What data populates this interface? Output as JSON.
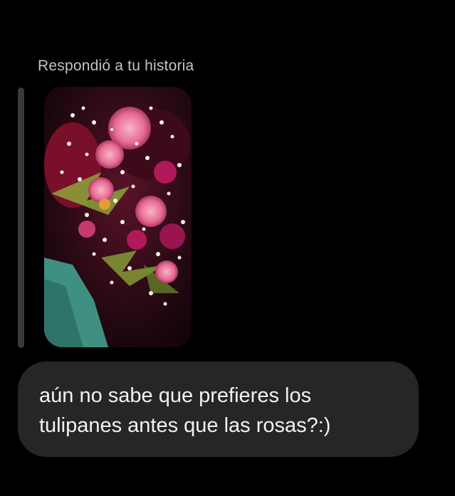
{
  "thread": {
    "reply_label": "Respondió a tu historia",
    "story_preview": {
      "icon": "bouquet-image",
      "description_colors": {
        "background": "#2a0a14",
        "accent_pink": "#e86a93",
        "accent_magenta": "#b0195a",
        "foliage": "#8fae3a",
        "teal": "#3f8f82"
      }
    },
    "message": {
      "text": "aún no sabe que prefieres los\ntulipanes antes que las rosas?:)"
    }
  }
}
